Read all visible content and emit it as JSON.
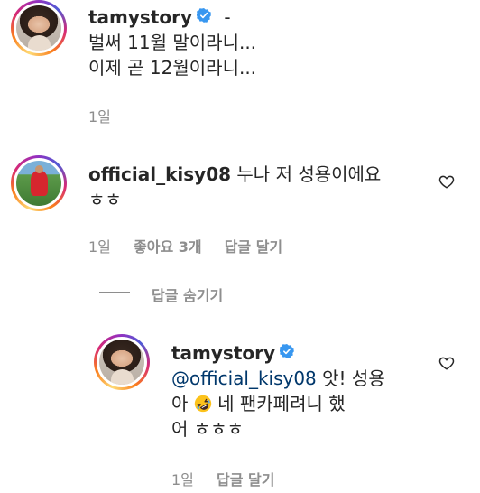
{
  "post": {
    "username": "tamystory",
    "verified": true,
    "separator": "-",
    "caption_lines": [
      "벌써 11월 말이라니...",
      "이제 곧 12월이라니..."
    ],
    "time": "1일"
  },
  "comment": {
    "username": "official_kisy08",
    "text_line1": "누나 저 성용이에요",
    "text_line2": "ㅎㅎ",
    "time": "1일",
    "likes": "좋아요 3개",
    "reply_label": "답글 달기",
    "hide_replies_label": "답글 숨기기"
  },
  "reply": {
    "username": "tamystory",
    "verified": true,
    "mention": "@official_kisy08",
    "text_line1_rest": " 앗! 성용",
    "text_line2_pre": "아 ",
    "emoji": "rolling-on-the-floor-laughing-emoji",
    "text_line2_post": " 네 팬카페려니 했",
    "text_line3": "어 ㅎㅎㅎ",
    "time": "1일",
    "reply_label": "답글 달기"
  },
  "icons": {
    "verified_color": "#3897f0",
    "heart_color": "#262626"
  }
}
